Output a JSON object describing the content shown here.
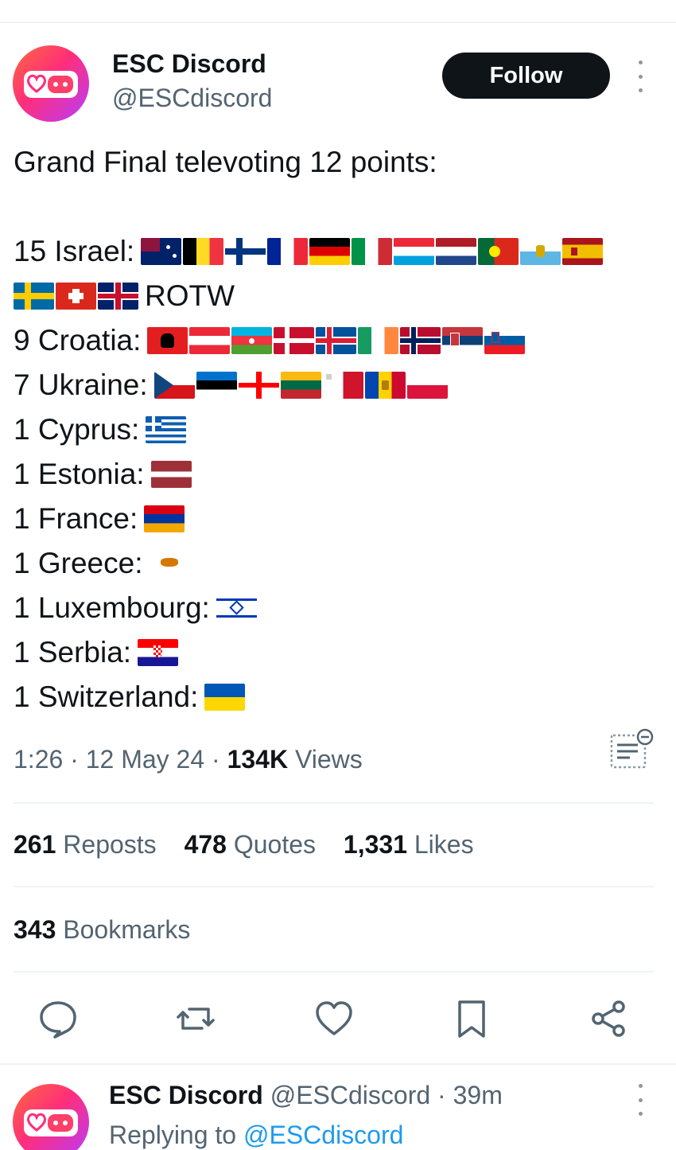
{
  "author": {
    "name": "ESC Discord",
    "handle": "@ESCdiscord",
    "follow_label": "Follow"
  },
  "tweet": {
    "intro": "Grand Final televoting 12 points:",
    "lines": [
      {
        "text": "15 Israel:",
        "flags": [
          "australia",
          "belgium",
          "finland",
          "france",
          "germany",
          "italy",
          "luxembourg",
          "netherlands",
          "portugal",
          "san-marino",
          "spain"
        ]
      },
      {
        "text": "ROTW",
        "flags_before": [
          "sweden",
          "switzerland",
          "united-kingdom"
        ]
      },
      {
        "text": "9 Croatia:",
        "flags": [
          "albania",
          "austria",
          "azerbaijan",
          "denmark",
          "iceland",
          "ireland",
          "norway",
          "serbia",
          "slovenia"
        ]
      },
      {
        "text": "7 Ukraine:",
        "flags": [
          "czechia",
          "estonia",
          "georgia",
          "lithuania",
          "malta",
          "moldova",
          "poland"
        ]
      },
      {
        "text": "1 Cyprus:",
        "flags": [
          "greece"
        ]
      },
      {
        "text": "1 Estonia:",
        "flags": [
          "latvia"
        ]
      },
      {
        "text": "1 France:",
        "flags": [
          "armenia"
        ]
      },
      {
        "text": "1 Greece:",
        "flags": [
          "cyprus"
        ]
      },
      {
        "text": "1 Luxembourg:",
        "flags": [
          "israel"
        ]
      },
      {
        "text": "1 Serbia:",
        "flags": [
          "croatia"
        ]
      },
      {
        "text": "1 Switzerland:",
        "flags": [
          "ukraine"
        ]
      }
    ]
  },
  "meta": {
    "time": "1:26",
    "date": "12 May 24",
    "views_count": "134K",
    "views_label": "Views"
  },
  "stats": {
    "reposts_count": "261",
    "reposts_label": "Reposts",
    "quotes_count": "478",
    "quotes_label": "Quotes",
    "likes_count": "1,331",
    "likes_label": "Likes",
    "bookmarks_count": "343",
    "bookmarks_label": "Bookmarks"
  },
  "actions": [
    "reply-icon",
    "repost-icon",
    "like-icon",
    "bookmark-icon",
    "share-icon"
  ],
  "reply": {
    "name": "ESC Discord",
    "handle": "@ESCdiscord",
    "sep": "·",
    "time": "39m",
    "replying_prefix": "Replying to",
    "replying_to": "@ESCdiscord"
  },
  "colors": {
    "text": "#0f1419",
    "secondary": "#536471",
    "accent": "#1d9bf0",
    "button": "#0f1419"
  }
}
